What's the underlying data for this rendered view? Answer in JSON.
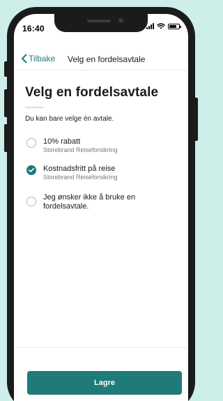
{
  "status_bar": {
    "time": "16:40",
    "icons": [
      "signal-icon",
      "wifi-icon",
      "battery-icon"
    ]
  },
  "nav": {
    "back_label": "Tilbake",
    "title": "Velg en fordelsavtale"
  },
  "page": {
    "heading": "Velg en fordelsavtale",
    "subtitle": "Du kan bare velge én avtale."
  },
  "options": [
    {
      "title": "10% rabatt",
      "subtitle": "Storebrand Reiseforsikring",
      "selected": false
    },
    {
      "title": "Kostnadsfritt på reise",
      "subtitle": "Storebrand Reiseforsikring",
      "selected": true
    },
    {
      "title": "Jeg ønsker ikke å bruke en fordelsavtale.",
      "subtitle": "",
      "selected": false
    }
  ],
  "footer": {
    "save_label": "Lagre"
  },
  "colors": {
    "accent": "#1f7a78",
    "background": "#cdeee9"
  }
}
